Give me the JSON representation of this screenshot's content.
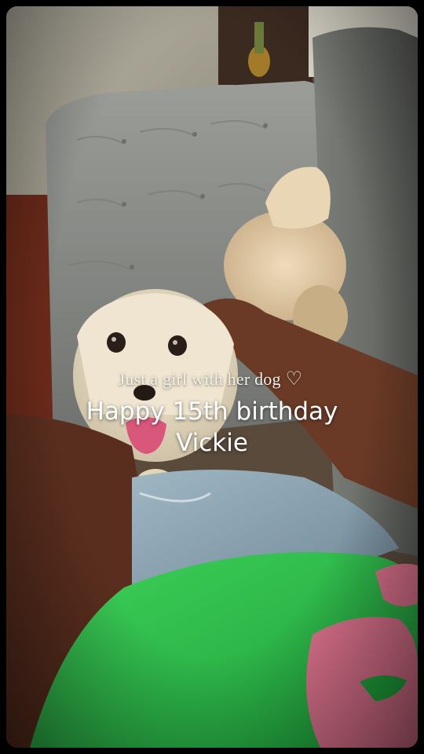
{
  "caption": {
    "subtitle": "Just a girl with her dog",
    "heart_icon": "♡",
    "title_line1": "Happy 15th birthday",
    "title_line2": "Vickie"
  }
}
